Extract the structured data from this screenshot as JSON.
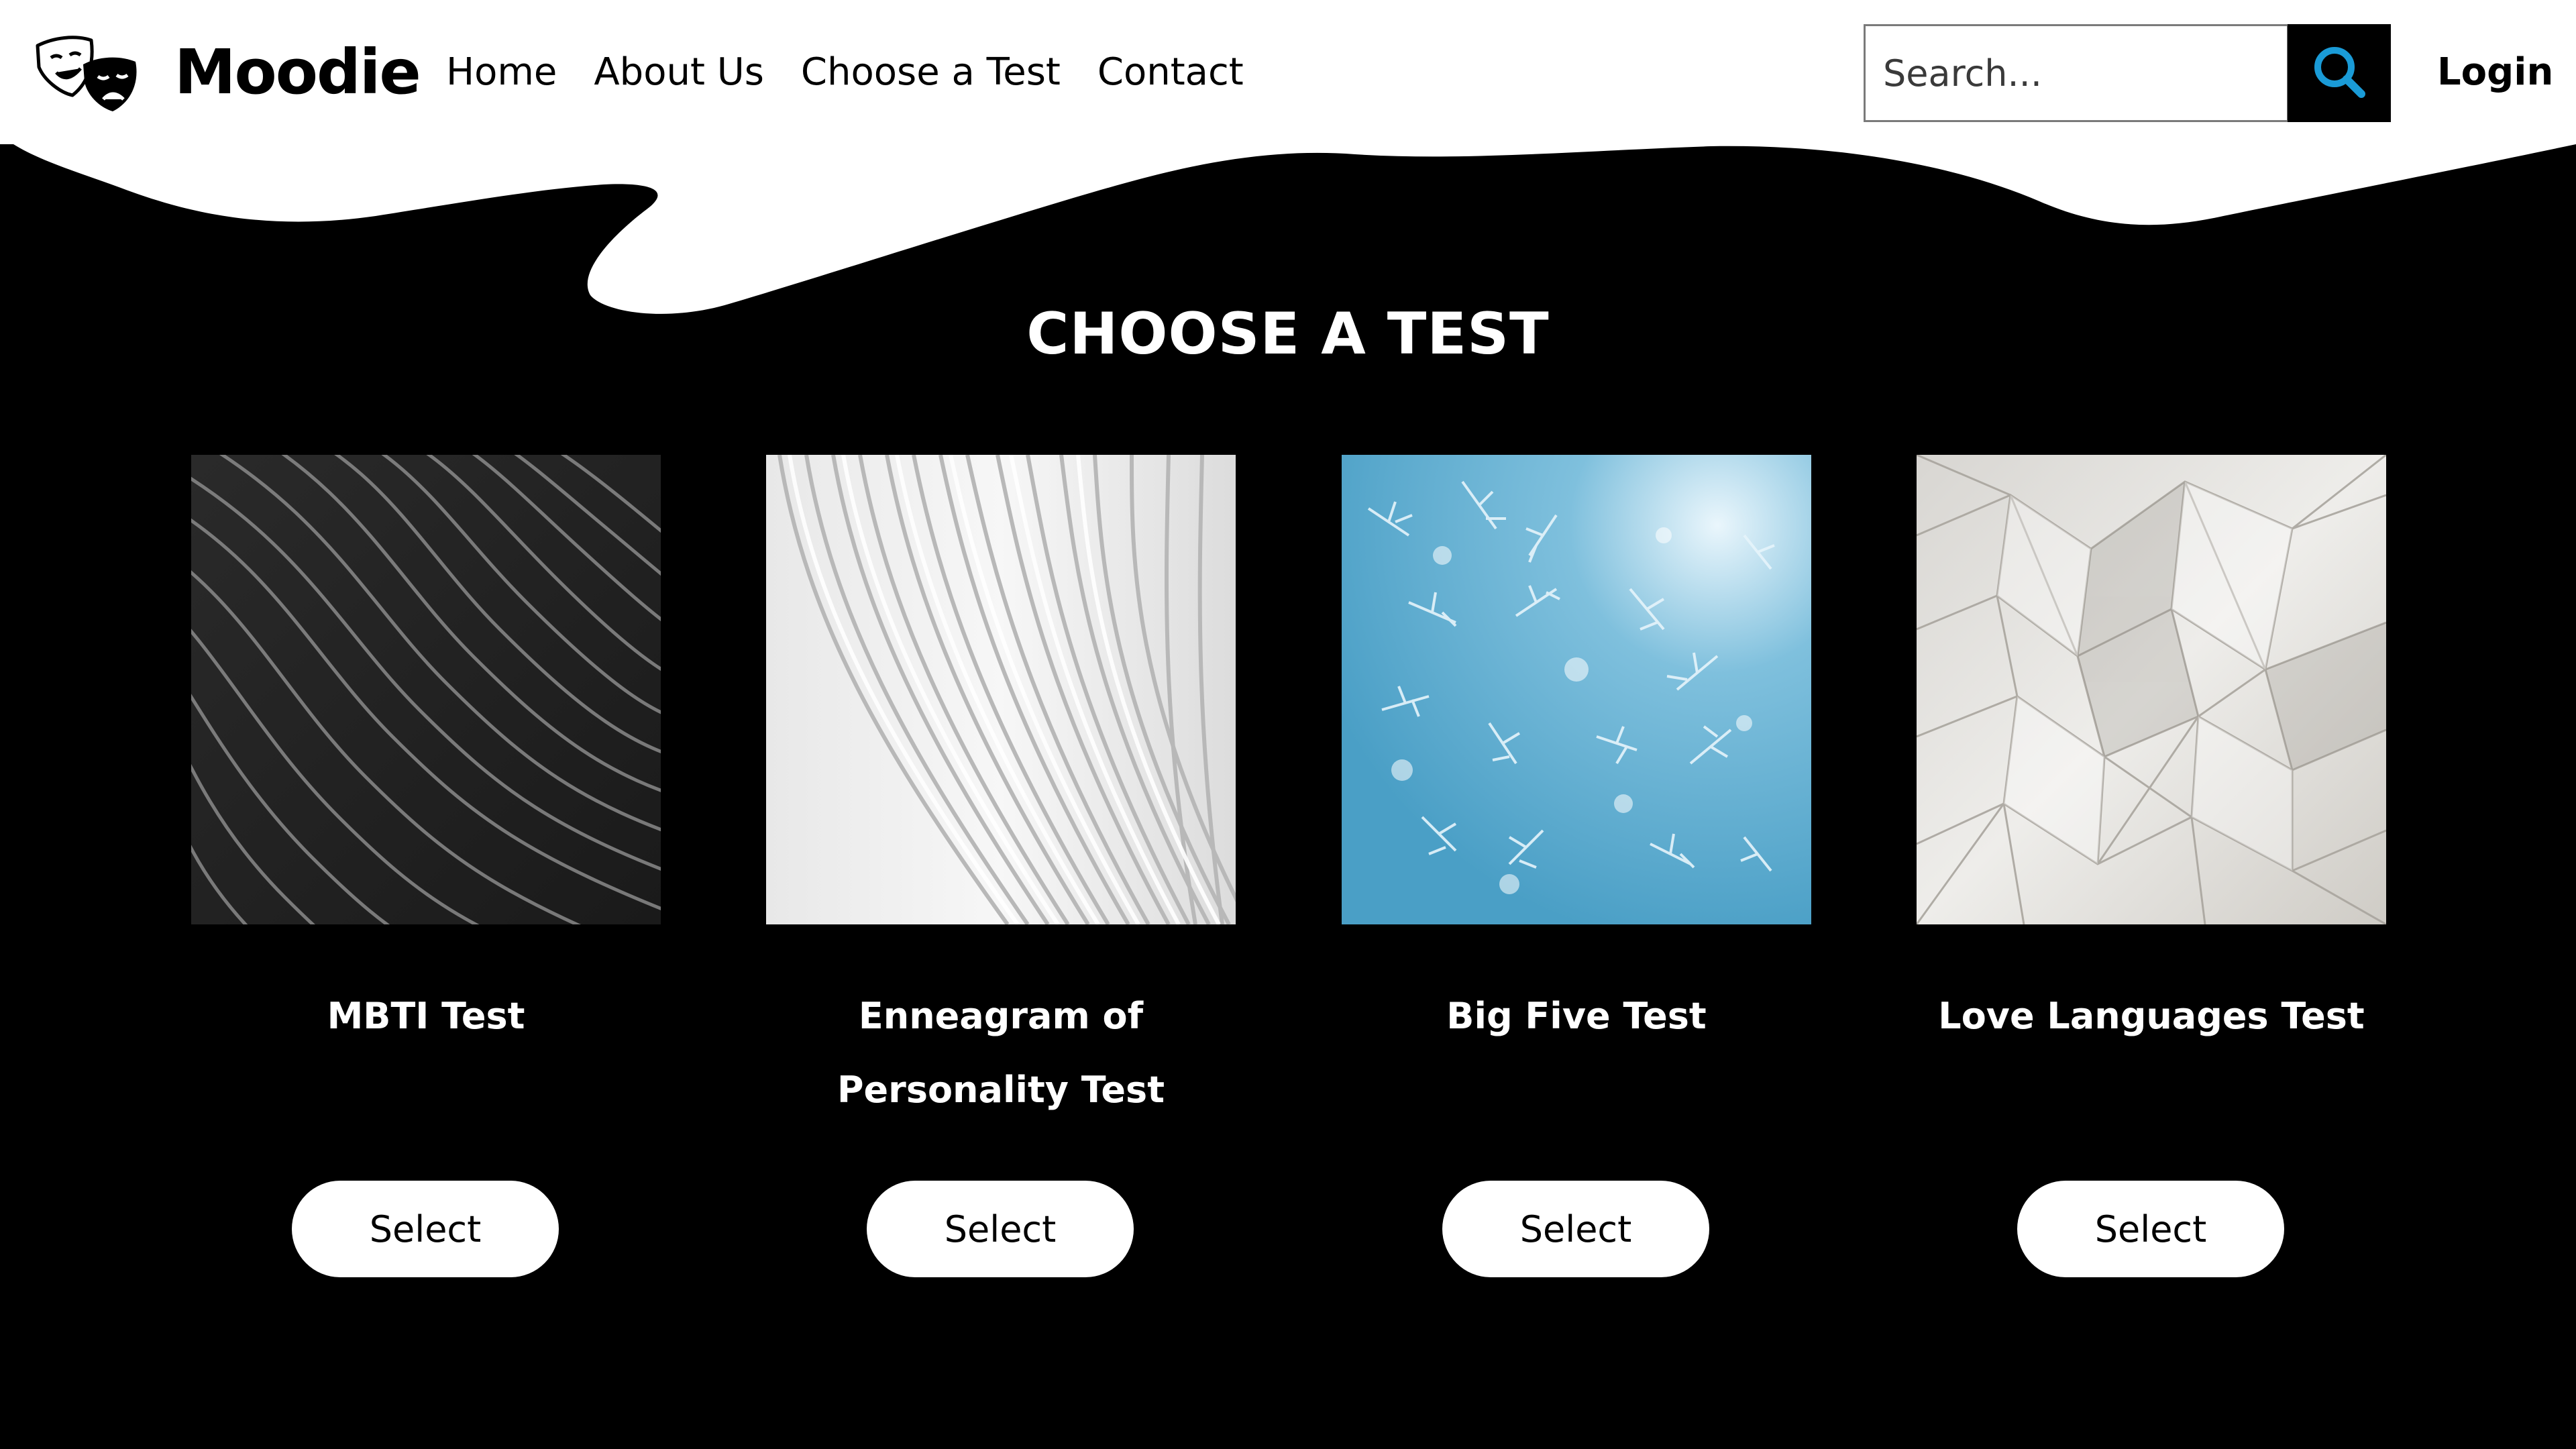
{
  "header": {
    "brand": "Moodie",
    "logo_icon": "theater-masks-icon",
    "nav": [
      {
        "label": "Home"
      },
      {
        "label": "About Us"
      },
      {
        "label": "Choose a Test"
      },
      {
        "label": "Contact"
      }
    ],
    "search": {
      "placeholder": "Search...",
      "value": "",
      "icon": "search-icon",
      "icon_color": "#1a9bd7"
    },
    "login_label": "Login"
  },
  "main": {
    "title": "CHOOSE A TEST",
    "cards": [
      {
        "title": "MBTI Test",
        "button": "Select",
        "image": "dark-wavy-lines-texture"
      },
      {
        "title": "Enneagram of Personality Test",
        "button": "Select",
        "image": "white-curved-ribs-architecture"
      },
      {
        "title": "Big Five Test",
        "button": "Select",
        "image": "blue-frost-crystals"
      },
      {
        "title": "Love Languages Test",
        "button": "Select",
        "image": "crumpled-paper-texture"
      }
    ]
  },
  "colors": {
    "background": "#000000",
    "header": "#ffffff",
    "accent": "#1a9bd7",
    "button": "#ffffff"
  }
}
